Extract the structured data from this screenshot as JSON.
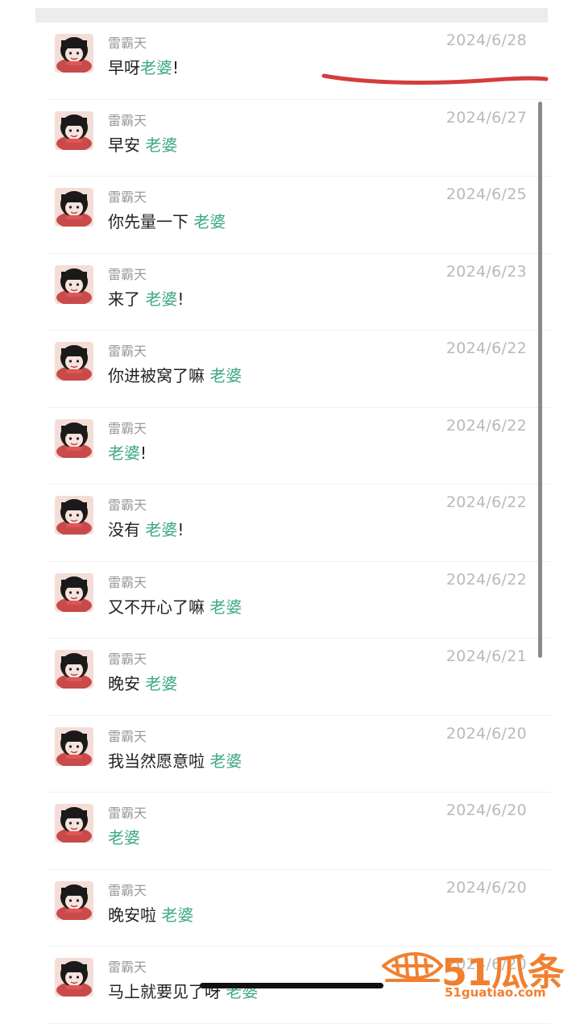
{
  "colors": {
    "keyword": "#3ea886",
    "date": "#b9b9b9",
    "sender": "#9a9a9a",
    "annotation": "#d43c3c",
    "watermark": "#f08030"
  },
  "messages": [
    {
      "sender": "雷霸天",
      "date": "2024/6/28",
      "pre": "早呀",
      "kw": "老婆",
      "post": "!"
    },
    {
      "sender": "雷霸天",
      "date": "2024/6/27",
      "pre": "早安 ",
      "kw": "老婆",
      "post": ""
    },
    {
      "sender": "雷霸天",
      "date": "2024/6/25",
      "pre": "你先量一下 ",
      "kw": "老婆",
      "post": ""
    },
    {
      "sender": "雷霸天",
      "date": "2024/6/23",
      "pre": "来了 ",
      "kw": "老婆",
      "post": "!"
    },
    {
      "sender": "雷霸天",
      "date": "2024/6/22",
      "pre": "你进被窝了嘛 ",
      "kw": "老婆",
      "post": ""
    },
    {
      "sender": "雷霸天",
      "date": "2024/6/22",
      "pre": "",
      "kw": "老婆",
      "post": "!"
    },
    {
      "sender": "雷霸天",
      "date": "2024/6/22",
      "pre": "没有 ",
      "kw": "老婆",
      "post": "!"
    },
    {
      "sender": "雷霸天",
      "date": "2024/6/22",
      "pre": "又不开心了嘛 ",
      "kw": "老婆",
      "post": ""
    },
    {
      "sender": "雷霸天",
      "date": "2024/6/21",
      "pre": "晚安 ",
      "kw": "老婆",
      "post": ""
    },
    {
      "sender": "雷霸天",
      "date": "2024/6/20",
      "pre": "我当然愿意啦 ",
      "kw": "老婆",
      "post": ""
    },
    {
      "sender": "雷霸天",
      "date": "2024/6/20",
      "pre": "",
      "kw": "老婆",
      "post": ""
    },
    {
      "sender": "雷霸天",
      "date": "2024/6/20",
      "pre": "晚安啦 ",
      "kw": "老婆",
      "post": ""
    },
    {
      "sender": "雷霸天",
      "date": "2024/6/20",
      "pre": "马上就要见了呀 ",
      "kw": "老婆",
      "post": ""
    }
  ],
  "watermark": {
    "brand": "51瓜条",
    "url": "51guatiao.com"
  }
}
